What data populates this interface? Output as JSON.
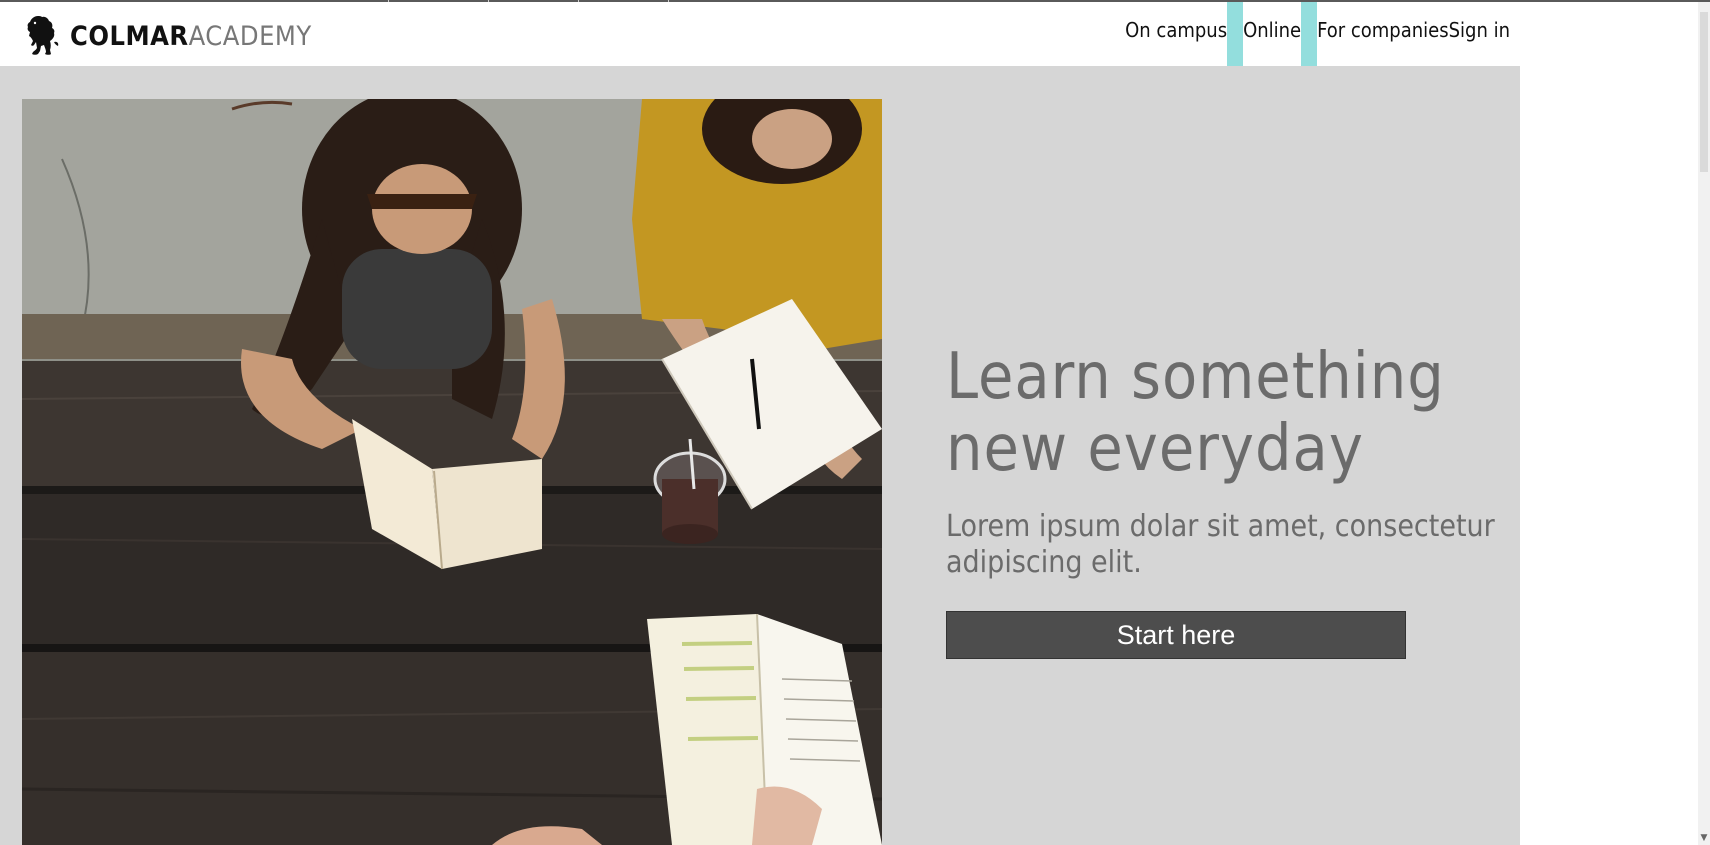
{
  "header": {
    "logo": {
      "strong": "COLMAR",
      "light": "ACADEMY"
    },
    "nav": [
      {
        "label": "On campus"
      },
      {
        "label": "Online"
      },
      {
        "label": "For companies"
      },
      {
        "label": "Sign in"
      }
    ]
  },
  "hero": {
    "headline_line1": "Learn something",
    "headline_line2": "new everyday",
    "subtext": "Lorem ipsum dolar sit amet, consectetur adipiscing elit.",
    "cta_label": "Start here"
  },
  "icons": {
    "logo_mark": "lion-icon",
    "scroll_down": "chevron-down-icon"
  },
  "colors": {
    "nav_separator": "#93dedd",
    "hero_background": "#d6d6d6",
    "cta_background": "#4d4d4d",
    "text_muted": "#6b6b6b"
  }
}
